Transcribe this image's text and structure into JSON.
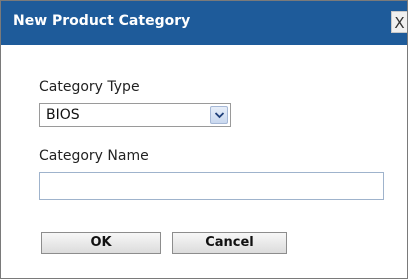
{
  "dialog": {
    "title": "New Product Category",
    "close_label": "X"
  },
  "form": {
    "category_type_label": "Category Type",
    "category_type_value": "BIOS",
    "category_name_label": "Category Name",
    "category_name_value": "",
    "category_name_placeholder": ""
  },
  "buttons": {
    "ok_label": "OK",
    "cancel_label": "Cancel"
  },
  "icons": {
    "dropdown": "chevron-down-icon"
  },
  "colors": {
    "titlebar": "#1e5b9a",
    "title_text": "#ffffff"
  }
}
